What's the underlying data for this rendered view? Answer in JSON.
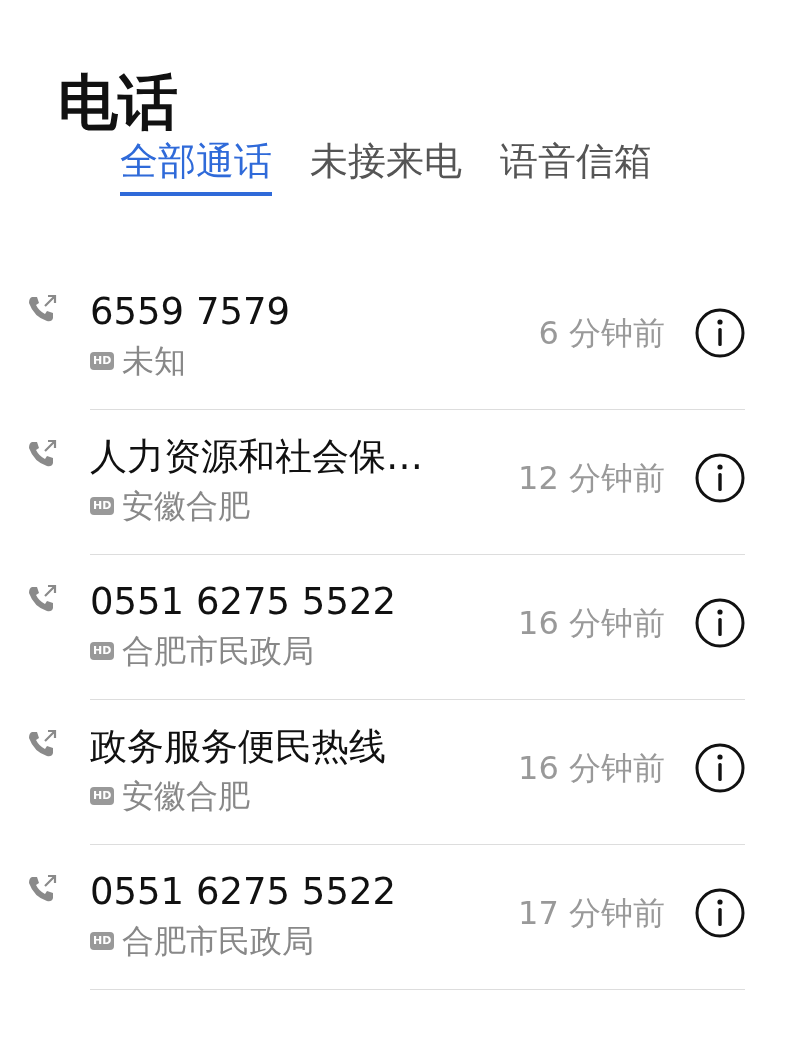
{
  "title": "电话",
  "tabs": [
    {
      "label": "全部通话",
      "selected": true
    },
    {
      "label": "未接来电",
      "selected": false
    },
    {
      "label": "语音信箱",
      "selected": false
    }
  ],
  "calls": [
    {
      "name": "6559 7579",
      "badge": "HD",
      "location": "未知",
      "time": "6 分钟前"
    },
    {
      "name": "人力资源和社会保…",
      "badge": "HD",
      "location": "安徽合肥",
      "time": "12 分钟前"
    },
    {
      "name": "0551 6275 5522",
      "badge": "HD",
      "location": "合肥市民政局",
      "time": "16 分钟前"
    },
    {
      "name": "政务服务便民热线",
      "badge": "HD",
      "location": "安徽合肥",
      "time": "16 分钟前"
    },
    {
      "name": "0551 6275 5522",
      "badge": "HD",
      "location": "合肥市民政局",
      "time": "17 分钟前"
    }
  ]
}
